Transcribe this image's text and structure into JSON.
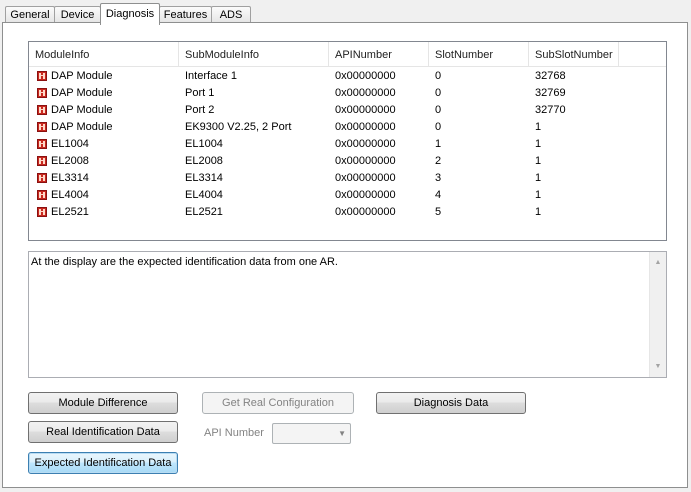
{
  "tabs": [
    {
      "label": "General",
      "active": false
    },
    {
      "label": "Device",
      "active": false
    },
    {
      "label": "Diagnosis",
      "active": true
    },
    {
      "label": "Features",
      "active": false
    },
    {
      "label": "ADS",
      "active": false
    }
  ],
  "table": {
    "columns": [
      "ModuleInfo",
      "SubModuleInfo",
      "APINumber",
      "SlotNumber",
      "SubSlotNumber"
    ],
    "rows": [
      [
        "DAP Module",
        "Interface 1",
        "0x00000000",
        "0",
        "32768"
      ],
      [
        "DAP Module",
        "Port 1",
        "0x00000000",
        "0",
        "32769"
      ],
      [
        "DAP Module",
        "Port 2",
        "0x00000000",
        "0",
        "32770"
      ],
      [
        "DAP Module",
        "EK9300 V2.25, 2 Port",
        "0x00000000",
        "0",
        "1"
      ],
      [
        "EL1004",
        "EL1004",
        "0x00000000",
        "1",
        "1"
      ],
      [
        "EL2008",
        "EL2008",
        "0x00000000",
        "2",
        "1"
      ],
      [
        "EL3314",
        "EL3314",
        "0x00000000",
        "3",
        "1"
      ],
      [
        "EL4004",
        "EL4004",
        "0x00000000",
        "4",
        "1"
      ],
      [
        "EL2521",
        "EL2521",
        "0x00000000",
        "5",
        "1"
      ]
    ],
    "row_icon": "module-icon"
  },
  "info_text": "At the display are the expected identification data from one AR.",
  "buttons": {
    "module_difference": "Module Difference",
    "get_real_configuration": "Get Real Configuration",
    "diagnosis_data": "Diagnosis Data",
    "real_identification_data": "Real Identification Data",
    "expected_identification_data": "Expected Identification Data"
  },
  "api_number_label": "API Number",
  "api_number_value": "",
  "colors": {
    "module_icon": "#c8281e",
    "default_button_border": "#3c7fb1"
  }
}
